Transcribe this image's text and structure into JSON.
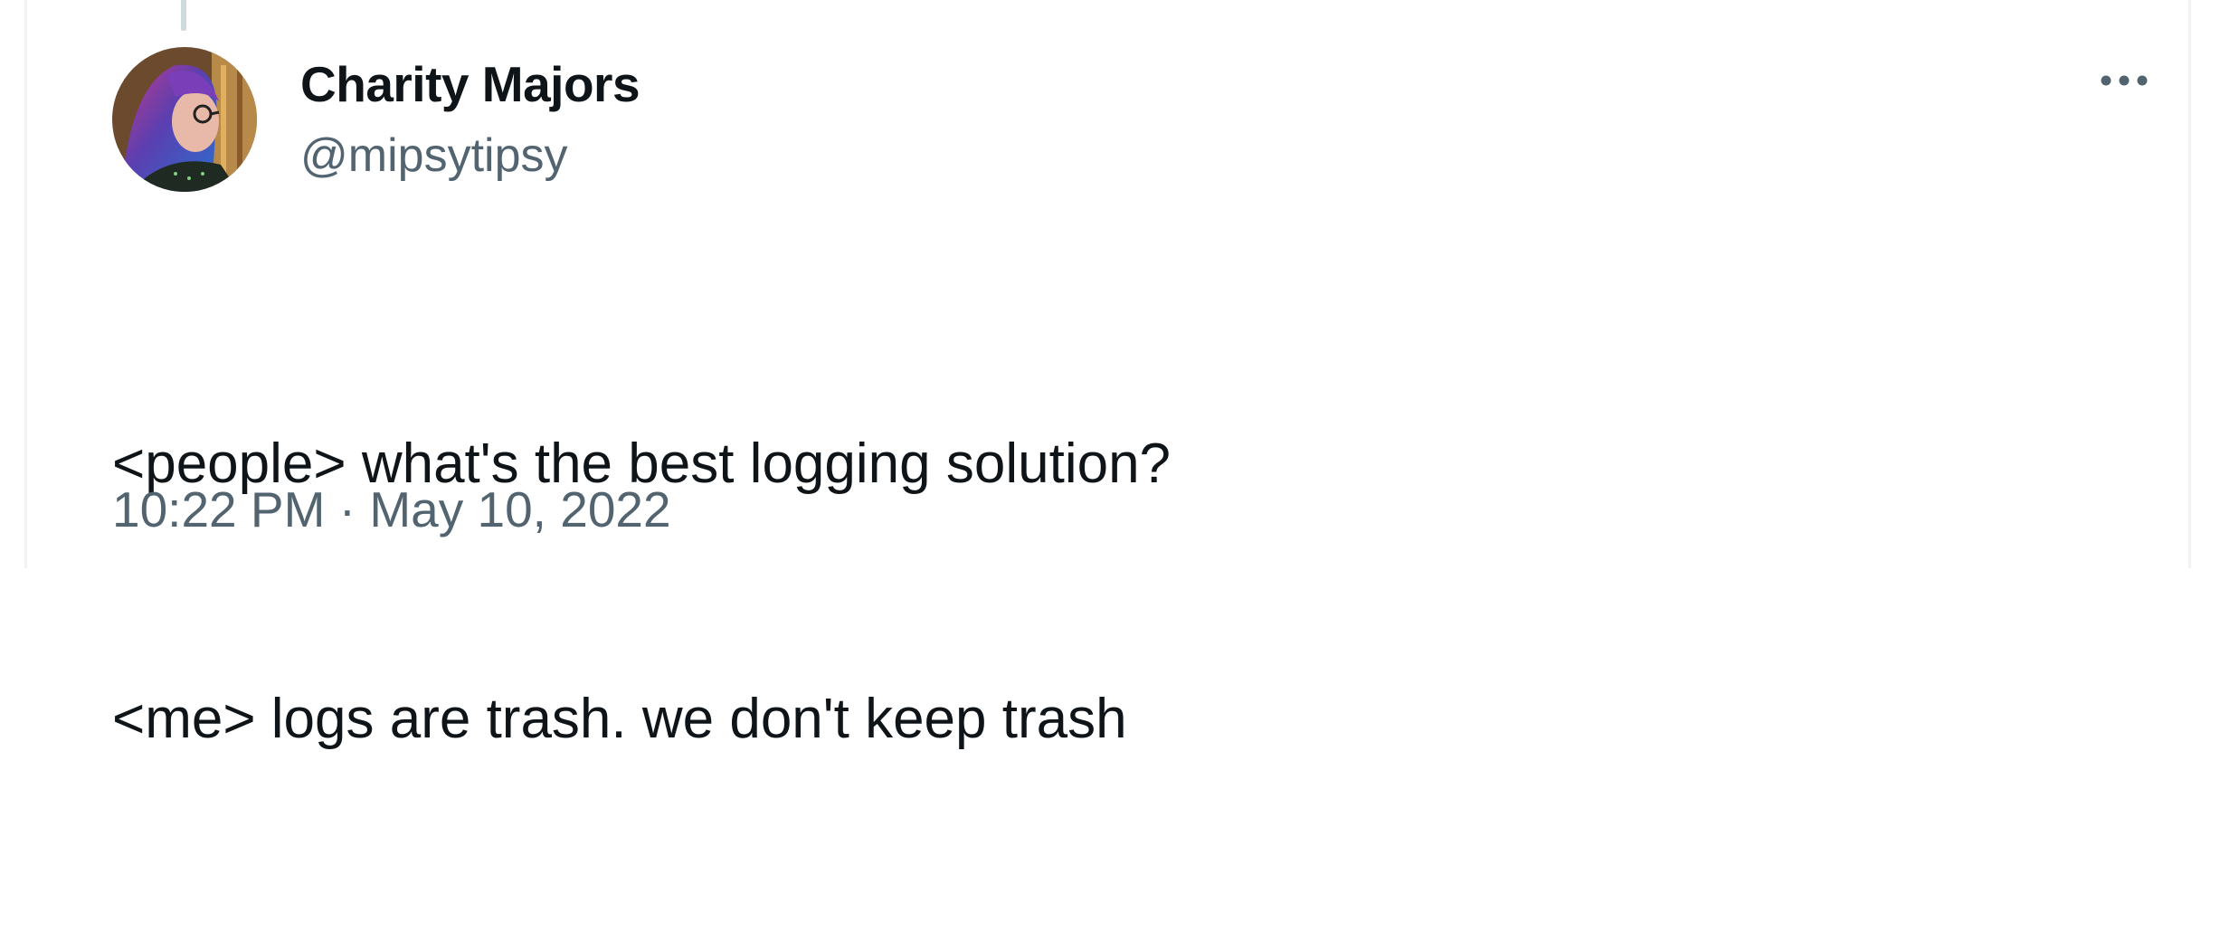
{
  "tweet": {
    "author": {
      "display_name": "Charity Majors",
      "handle": "@mipsytipsy",
      "avatar_icon": "profile-avatar"
    },
    "more_icon": "more-horizontal-icon",
    "text_lines": [
      "<people> what's the best logging solution?",
      "<me> logs are trash. we don't keep trash"
    ],
    "time": "10:22 PM",
    "separator": "·",
    "date": "May 10, 2022"
  },
  "colors": {
    "text_primary": "#0f1419",
    "text_secondary": "#536471",
    "border": "#eff3f4",
    "thread_line": "#cfd9de"
  }
}
